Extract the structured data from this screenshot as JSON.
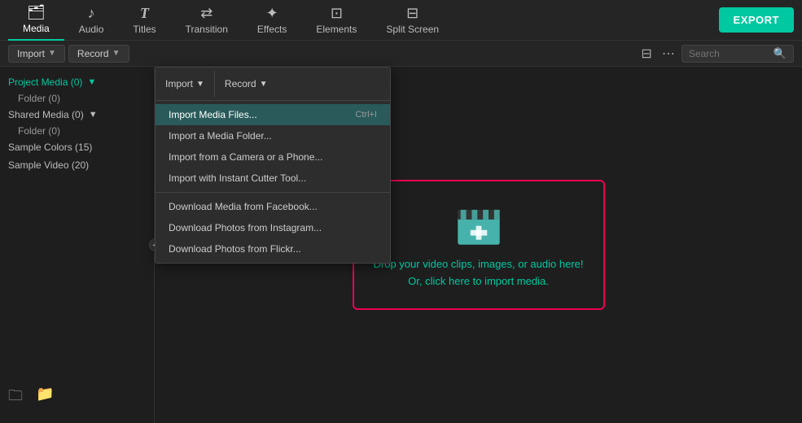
{
  "topNav": {
    "items": [
      {
        "label": "Media",
        "icon": "🗂",
        "active": true
      },
      {
        "label": "Audio",
        "icon": "♪"
      },
      {
        "label": "Titles",
        "icon": "T"
      },
      {
        "label": "Transition",
        "icon": "⇄"
      },
      {
        "label": "Effects",
        "icon": "✦"
      },
      {
        "label": "Elements",
        "icon": "⊡"
      },
      {
        "label": "Split Screen",
        "icon": "⊟"
      }
    ],
    "exportLabel": "EXPORT"
  },
  "toolbar": {
    "importLabel": "Import",
    "recordLabel": "Record",
    "searchPlaceholder": "Search"
  },
  "sidebar": {
    "projectMedia": "Project Media (0)",
    "folder1": "Folder (0)",
    "sharedMedia": "Shared Media (0)",
    "folder2": "Folder (0)",
    "sampleColors": "Sample Colors (15)",
    "sampleVideo": "Sample Video (20)"
  },
  "importMenu": {
    "header": "Import",
    "recordHeader": "Record",
    "items": [
      {
        "label": "Import Media Files...",
        "shortcut": "Ctrl+I",
        "highlighted": true
      },
      {
        "label": "Import a Media Folder..."
      },
      {
        "label": "Import from a Camera or a Phone..."
      },
      {
        "label": "Import with Instant Cutter Tool..."
      },
      {
        "label": "Download Media from Facebook..."
      },
      {
        "label": "Download Photos from Instagram..."
      },
      {
        "label": "Download Photos from Flickr..."
      }
    ]
  },
  "dropZone": {
    "line1": "Drop your video clips, images, or audio here!",
    "line2": "Or, click here to import media."
  }
}
